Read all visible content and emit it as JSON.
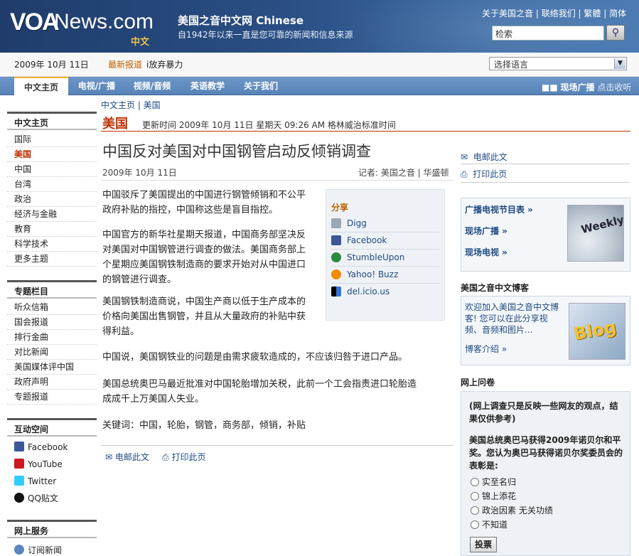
{
  "header": {
    "logo_text": "VOANews.com",
    "logo_sub": "中文",
    "site_title": "美国之音中文网 Chinese",
    "site_subtitle": "自1942年以来一直是您可靠的新闻和信息来源",
    "top_links": [
      "关于美国之音",
      "联络我们",
      "繁體",
      "简体"
    ],
    "search_value": "检索"
  },
  "datebar": {
    "date": "2009年 10月 11日",
    "latest_label": "最新报道",
    "latest_text": "i放弃暴力",
    "language_select": "选择语言"
  },
  "nav": {
    "tabs": [
      "中文主页",
      "电视/广播",
      "视频/音频",
      "英语教学",
      "关于我们"
    ],
    "live_label": "现场广播",
    "live_sub": "点击收听"
  },
  "breadcrumb": "中文主页 | 美国",
  "section": {
    "name": "美国",
    "updated": "更新时间 2009年 10月 11日 星期天 09:26 AM 格林威治标准时间"
  },
  "sidebar": {
    "main_head": "中文主页",
    "main_items": [
      "国际",
      "美国",
      "中国",
      "台湾",
      "政治",
      "经济与金融",
      "教育",
      "科学技术",
      "更多主题"
    ],
    "topics_head": "专题栏目",
    "topics_items": [
      "听众信箱",
      "国会报道",
      "排行金曲",
      "对比新闻",
      "美国媒体评中国",
      "政府声明",
      "专题报道"
    ],
    "social_head": "互动空间",
    "social_items": [
      "Facebook",
      "YouTube",
      "Twitter",
      "QQ贴文"
    ],
    "service_head": "网上服务",
    "service_items": [
      "订阅新闻"
    ]
  },
  "article": {
    "headline": "中国反对美国对中国钢管启动反倾销调查",
    "date": "2009年 10月 11日",
    "byline": "记者: 美国之音 | 华盛顿",
    "p1": [
      "中国驳斥了美国提出的中国进行钢管倾销和不公平",
      "政府补贴的指控，中国称这些是盲目指控。"
    ],
    "p2": [
      "中国官方的新华社星期天报道，中国商务部坚决反",
      "对美国对中国钢管进行调查的做法。美国商务部上",
      "个星期应美国钢铁制造商的要求开始对从中国进口",
      "的钢管进行调查。"
    ],
    "p3": [
      "美国钢铁制造商说，中国生产商以低于生产成本的",
      "价格向美国出售钢管，并且从大量政府的补贴中获",
      "得利益。"
    ],
    "p4": [
      "中国说，美国钢铁业的问题是由需求疲软造成的，不应该归咎于进口产品。"
    ],
    "p5": [
      "美国总统奥巴马最近批准对中国轮胎增加关税，此前一个工会指责进口轮胎造",
      "成成千上万美国人失业。"
    ],
    "keywords": "关键词：中国，轮胎，钢管，商务部，倾销，补贴",
    "email_label": "电邮此文",
    "print_label": "打印此页"
  },
  "share": {
    "title": "分享",
    "items": [
      "Digg",
      "Facebook",
      "StumbleUpon",
      "Yahoo! Buzz",
      "del.icio.us"
    ]
  },
  "right": {
    "email_label": "电邮此文",
    "print_label": "打印此页",
    "box1_links": [
      "广播电视节目表 »",
      "现场广播 »",
      "现场电视 »"
    ],
    "weekly_text": "Weekly",
    "blog_title": "美国之音中文博客",
    "blog_text": "欢迎加入美国之音中文博客! 您可以在此分享视频、音频和图片...",
    "blog_more": "博客介绍 »",
    "blog_img_text": "Blog",
    "poll_title": "网上问卷",
    "poll_note": "(网上调查只是反映一些网友的观点，结果仅供参考)",
    "poll_question": "美国总统奥巴马获得2009年诺贝尔和平奖。您认为奥巴马获得诺贝尔奖委员会的表彰是:",
    "poll_options": [
      "实至名归",
      "锦上添花",
      "政治因素 无关功绩",
      "不知道"
    ],
    "vote_label": "投票"
  },
  "colors": {
    "header_blue": "#1f3c6b",
    "nav_blue": "#5783b8",
    "section_red": "#c03000",
    "link_blue": "#1f4a82",
    "accent_orange": "#c06000"
  }
}
